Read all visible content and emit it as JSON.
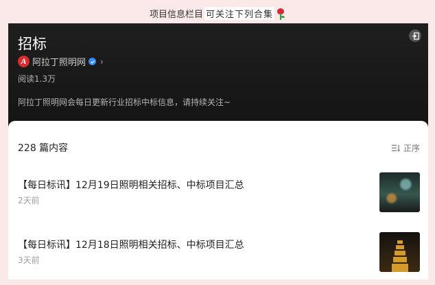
{
  "caption": {
    "prefix": "项目信息栏目",
    "highlight": "可关注下列合集",
    "icon": "rose-icon"
  },
  "header": {
    "title": "招标",
    "source_name": "阿拉丁照明网",
    "reads": "阅读1.3万",
    "description": "阿拉丁照明网会每日更新行业招标中标信息，请持续关注~",
    "logo_letter": "A"
  },
  "list": {
    "count": "228 篇内容",
    "sort_label": "正序",
    "items": [
      {
        "title": "【每日标讯】12月19日照明相关招标、中标项目汇总",
        "time": "2天前"
      },
      {
        "title": "【每日标讯】12月18日照明相关招标、中标项目汇总",
        "time": "3天前"
      }
    ]
  },
  "colors": {
    "page_bg": "#fbe9ea",
    "header_bg": "#1a1a1a",
    "logo_red": "#d82c2c",
    "verified_blue": "#2f8cf7"
  }
}
